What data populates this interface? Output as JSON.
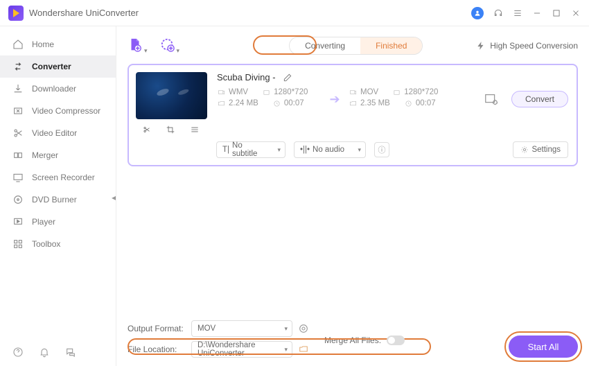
{
  "app": {
    "title": "Wondershare UniConverter"
  },
  "sidebar": {
    "items": [
      {
        "label": "Home"
      },
      {
        "label": "Converter"
      },
      {
        "label": "Downloader"
      },
      {
        "label": "Video Compressor"
      },
      {
        "label": "Video Editor"
      },
      {
        "label": "Merger"
      },
      {
        "label": "Screen Recorder"
      },
      {
        "label": "DVD Burner"
      },
      {
        "label": "Player"
      },
      {
        "label": "Toolbox"
      }
    ]
  },
  "tabs": {
    "converting": "Converting",
    "finished": "Finished"
  },
  "hsc": "High Speed Conversion",
  "file": {
    "name": "Scuba Diving -",
    "src": {
      "format": "WMV",
      "res": "1280*720",
      "size": "2.24 MB",
      "dur": "00:07"
    },
    "dst": {
      "format": "MOV",
      "res": "1280*720",
      "size": "2.35 MB",
      "dur": "00:07"
    },
    "subtitle": "No subtitle",
    "audio": "No audio",
    "settings": "Settings",
    "convert": "Convert"
  },
  "footer": {
    "output_format_label": "Output Format:",
    "output_format": "MOV",
    "file_location_label": "File Location:",
    "file_location": "D:\\Wondershare UniConverter",
    "merge": "Merge All Files:",
    "start": "Start All"
  }
}
